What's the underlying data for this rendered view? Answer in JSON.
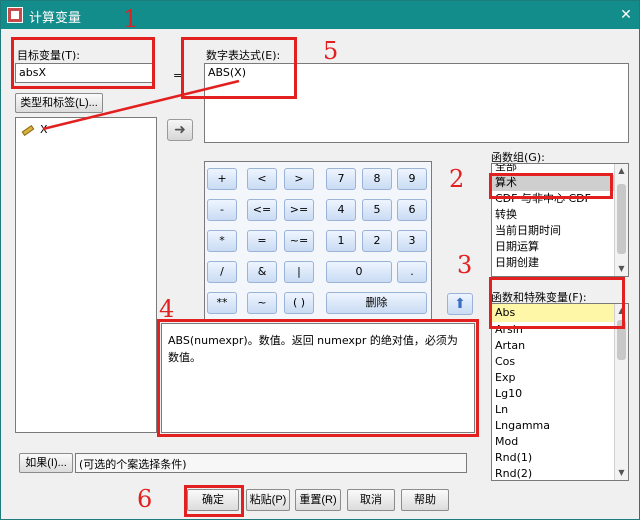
{
  "window": {
    "title": "计算变量",
    "close": "✕"
  },
  "target": {
    "label": "目标变量(T):",
    "value": "absX",
    "type_button": "类型和标签(L)..."
  },
  "expression": {
    "label": "数字表达式(E):",
    "value": "ABS(X)",
    "equals": "="
  },
  "variables": [
    {
      "name": "X"
    }
  ],
  "keypad": {
    "row1": [
      "+",
      "<",
      ">",
      "7",
      "8",
      "9"
    ],
    "row2": [
      "-",
      "<=",
      ">=",
      "4",
      "5",
      "6"
    ],
    "row3": [
      "*",
      "=",
      "~=",
      "1",
      "2",
      "3"
    ],
    "row4": [
      "/",
      "&",
      "|",
      "0",
      "."
    ],
    "row5": [
      "**",
      "~",
      "( )"
    ],
    "delete": "删除"
  },
  "function_group": {
    "label": "函数组(G):",
    "items": [
      "全部",
      "算术",
      "CDF 与非中心 CDF",
      "转换",
      "当前日期时间",
      "日期运算",
      "日期创建"
    ],
    "selected_index": 1
  },
  "functions": {
    "label": "函数和特殊变量(F):",
    "items": [
      "Abs",
      "Arsin",
      "Artan",
      "Cos",
      "Exp",
      "Lg10",
      "Ln",
      "Lngamma",
      "Mod",
      "Rnd(1)",
      "Rnd(2)"
    ],
    "selected_index": 0
  },
  "description": "ABS(numexpr)。数值。返回 numexpr 的绝对值，必须为数值。",
  "condition": {
    "button": "如果(I)...",
    "text": "(可选的个案选择条件)"
  },
  "footer": {
    "ok": "确定",
    "paste": "粘贴(P)",
    "reset": "重置(R)",
    "cancel": "取消",
    "help": "帮助"
  },
  "annotations": [
    "1",
    "2",
    "3",
    "4",
    "5",
    "6"
  ],
  "colors": {
    "titlebar": "#138c8c",
    "annotation": "#e32020",
    "keypad": "#c9dbf3"
  }
}
